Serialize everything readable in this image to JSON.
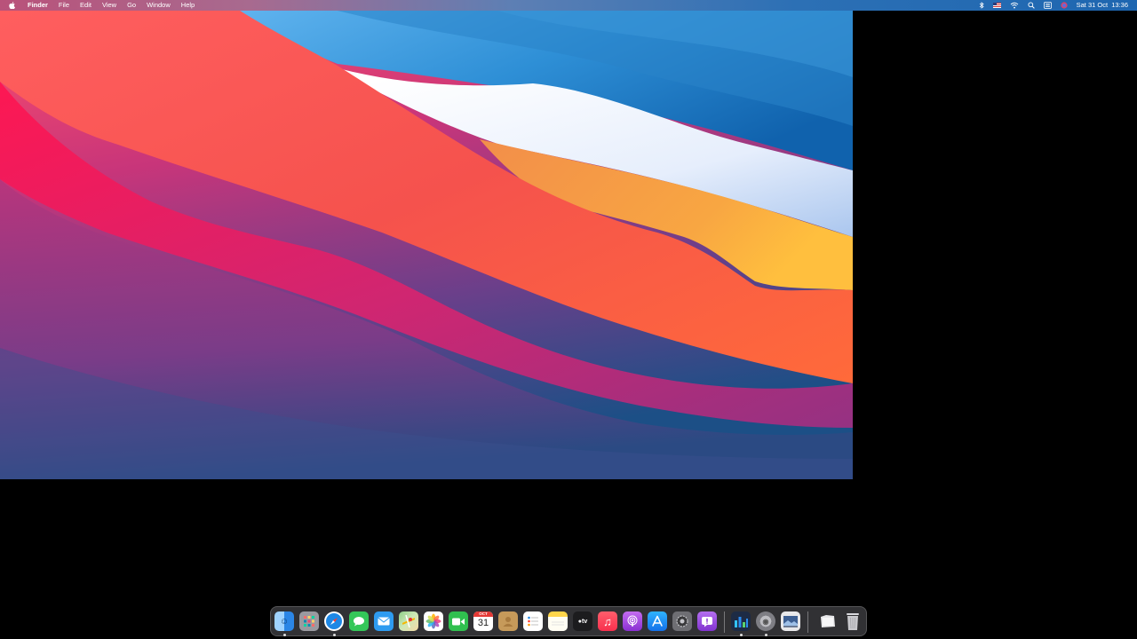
{
  "menubar": {
    "app_name": "Finder",
    "menus": [
      "File",
      "Edit",
      "View",
      "Go",
      "Window",
      "Help"
    ],
    "clock": "Sat 31 Oct  13:36",
    "status_icons": [
      "bluetooth-icon",
      "flag-us-icon",
      "wifi-icon",
      "spotlight-icon",
      "control-center-icon",
      "siri-icon"
    ]
  },
  "dock": {
    "calendar_month": "OCT",
    "calendar_day": "31",
    "tv_label": "tv",
    "apps": [
      {
        "name": "finder",
        "color": "#2f8ff0",
        "running": true
      },
      {
        "name": "launchpad",
        "color": "#8e8e93",
        "running": false
      },
      {
        "name": "safari",
        "color": "#1e88e5",
        "running": true
      },
      {
        "name": "messages",
        "color": "#34c759",
        "running": false
      },
      {
        "name": "mail",
        "color": "#2e9bf0",
        "running": false
      },
      {
        "name": "maps",
        "color": "#6cc36c",
        "running": false
      },
      {
        "name": "photos",
        "color": "#f4f4f4",
        "running": false
      },
      {
        "name": "facetime",
        "color": "#30c04f",
        "running": false
      },
      {
        "name": "calendar",
        "color": "#ffffff",
        "running": false
      },
      {
        "name": "contacts",
        "color": "#c69a5a",
        "running": false
      },
      {
        "name": "reminders",
        "color": "#ffffff",
        "running": false
      },
      {
        "name": "notes",
        "color": "#ffd54a",
        "running": false
      },
      {
        "name": "apple-tv",
        "color": "#1c1c1e",
        "running": false
      },
      {
        "name": "music",
        "color": "#fa3c5a",
        "running": false
      },
      {
        "name": "podcasts",
        "color": "#a44bd8",
        "running": false
      },
      {
        "name": "app-store",
        "color": "#1a8cf0",
        "running": false
      },
      {
        "name": "system-preferences",
        "color": "#6e6e73",
        "running": false
      },
      {
        "name": "feedback-assistant",
        "color": "#9b4ed6",
        "running": false
      },
      {
        "name": "activity-monitor",
        "color": "#2b6fd6",
        "running": true
      },
      {
        "name": "disk-utility",
        "color": "#8a8a8f",
        "running": true
      },
      {
        "name": "preview",
        "color": "#5a7ab0",
        "running": false
      },
      {
        "name": "downloads",
        "color": "#e8e8ea",
        "running": false
      },
      {
        "name": "trash",
        "color": "#c8c8cc",
        "running": false
      }
    ]
  }
}
